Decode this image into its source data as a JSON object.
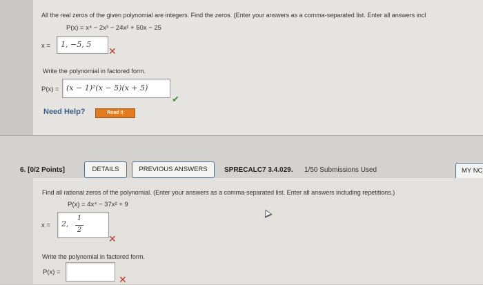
{
  "q5": {
    "instruction": "All the real zeros of the given polynomial are integers. Find the zeros. (Enter your answers as a comma-separated list. Enter all answers incl",
    "polynomial": "P(x) = x⁴ − 2x³ − 24x² + 50x − 25",
    "zeros_prefix": "x =",
    "zeros_answer": "1, −5, 5",
    "factored_prompt": "Write the polynomial in factored form.",
    "factored_prefix": "P(x) =",
    "factored_answer": "(x − 1)²(x − 5)(x + 5)",
    "help_label": "Need Help?",
    "read_it_label": "Read It"
  },
  "q6": {
    "number_label": "6.  [0/2 Points]",
    "details_label": "DETAILS",
    "previous_answers_label": "PREVIOUS ANSWERS",
    "course_label": "SPRECALC7 3.4.029.",
    "submissions_label": "1/50 Submissions Used",
    "my_notes_label": "MY NC",
    "instruction": "Find all rational zeros of the polynomial. (Enter your answers as a comma-separated list. Enter all answers including repetitions.)",
    "polynomial": "P(x) = 4x⁴ − 37x² + 9",
    "zeros_prefix": "x =",
    "zeros_answer_int": "2,",
    "zeros_answer_num": "1",
    "zeros_answer_den": "2",
    "factored_prompt": "Write the polynomial in factored form.",
    "factored_prefix": "P(x) ="
  },
  "colors": {
    "incorrect": "#c0392b",
    "correct": "#3e8e3e",
    "read_it": "#e07b1f",
    "button_border": "#4f6f8a"
  },
  "icons": {
    "incorrect": "x-mark-icon",
    "correct": "check-mark-icon"
  }
}
